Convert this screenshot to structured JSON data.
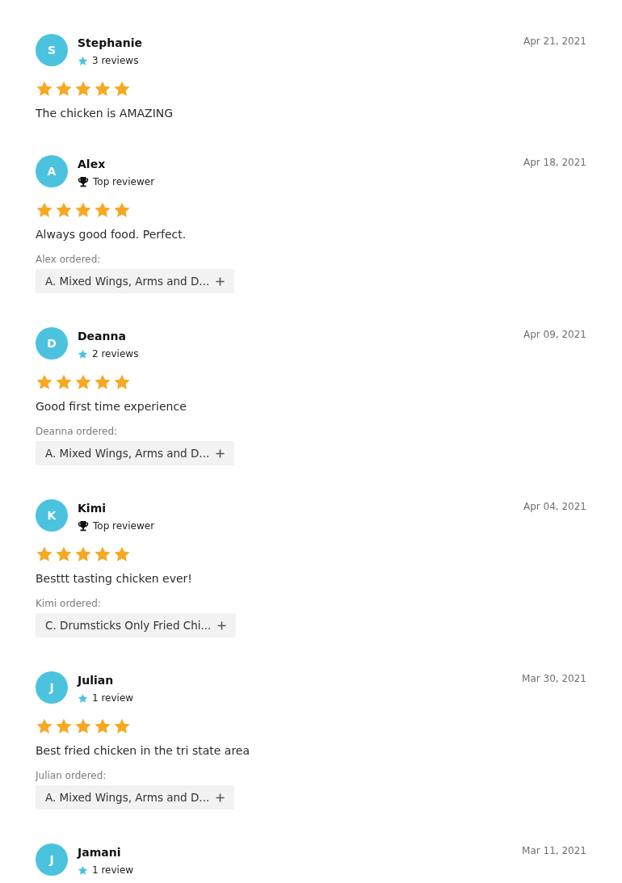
{
  "reviews": [
    {
      "initial": "S",
      "name": "Stephanie",
      "badge": {
        "kind": "count",
        "label": "3 reviews"
      },
      "date": "Apr 21, 2021",
      "stars": 5,
      "text": "The chicken is AMAZING"
    },
    {
      "initial": "A",
      "name": "Alex",
      "badge": {
        "kind": "top",
        "label": "Top reviewer"
      },
      "date": "Apr 18, 2021",
      "stars": 5,
      "text": "Always good food. Perfect.",
      "ordered_label": "Alex ordered:",
      "ordered_items": [
        "A. Mixed Wings, Arms and D..."
      ]
    },
    {
      "initial": "D",
      "name": "Deanna",
      "badge": {
        "kind": "count",
        "label": "2 reviews"
      },
      "date": "Apr 09, 2021",
      "stars": 5,
      "text": "Good first time experience",
      "ordered_label": "Deanna ordered:",
      "ordered_items": [
        "A. Mixed Wings, Arms and D..."
      ]
    },
    {
      "initial": "K",
      "name": "Kimi",
      "badge": {
        "kind": "top",
        "label": "Top reviewer"
      },
      "date": "Apr 04, 2021",
      "stars": 5,
      "text": "Besttt tasting chicken ever!",
      "ordered_label": "Kimi ordered:",
      "ordered_items": [
        "C. Drumsticks Only Fried Chi..."
      ]
    },
    {
      "initial": "J",
      "name": "Julian",
      "badge": {
        "kind": "count",
        "label": "1 review"
      },
      "date": "Mar 30, 2021",
      "stars": 5,
      "text": "Best fried chicken in the tri state area",
      "ordered_label": "Julian ordered:",
      "ordered_items": [
        "A. Mixed Wings, Arms and D..."
      ]
    },
    {
      "initial": "J",
      "name": "Jamani",
      "badge": {
        "kind": "count",
        "label": "1 review"
      },
      "date": "Mar 11, 2021"
    }
  ]
}
